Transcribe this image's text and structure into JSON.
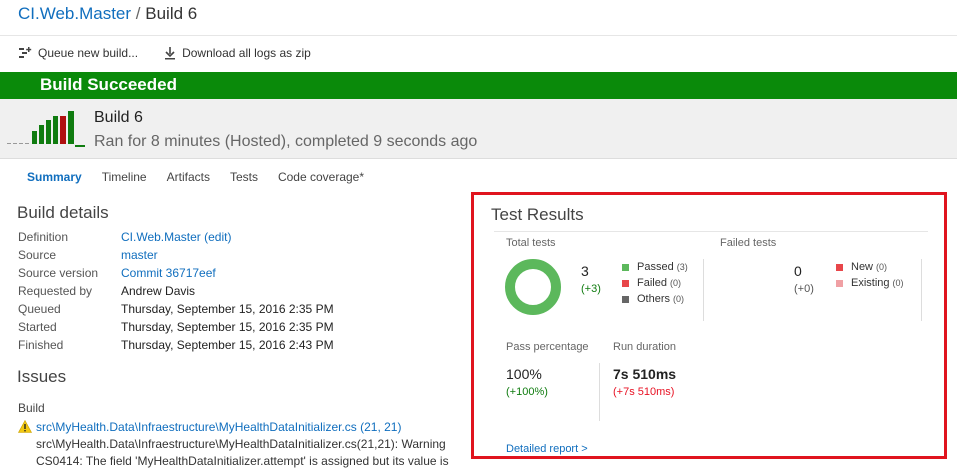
{
  "breadcrumb": {
    "project": "CI.Web.Master",
    "separator": "/",
    "build": "Build 6"
  },
  "toolbar": {
    "queue_label": "Queue new build...",
    "download_label": "Download all logs as zip"
  },
  "banner": {
    "text": "Build Succeeded",
    "color": "#0a8a0a"
  },
  "build": {
    "title": "Build 6",
    "subtitle": "Ran for 8 minutes (Hosted), completed 9 seconds ago"
  },
  "tabs": [
    {
      "label": "Summary",
      "active": true
    },
    {
      "label": "Timeline",
      "active": false
    },
    {
      "label": "Artifacts",
      "active": false
    },
    {
      "label": "Tests",
      "active": false
    },
    {
      "label": "Code coverage*",
      "active": false
    }
  ],
  "details": {
    "title": "Build details",
    "rows": [
      {
        "label": "Definition",
        "value": "CI.Web.Master (edit)",
        "link": true
      },
      {
        "label": "Source",
        "value": "master",
        "link": true
      },
      {
        "label": "Source version",
        "value": "Commit 36717eef",
        "link": true
      },
      {
        "label": "Requested by",
        "value": "Andrew Davis",
        "link": false
      },
      {
        "label": "Queued",
        "value": "Thursday, September 15, 2016 2:35 PM",
        "link": false
      },
      {
        "label": "Started",
        "value": "Thursday, September 15, 2016 2:35 PM",
        "link": false
      },
      {
        "label": "Finished",
        "value": "Thursday, September 15, 2016 2:43 PM",
        "link": false
      }
    ]
  },
  "issues": {
    "title": "Issues",
    "group": "Build",
    "items": [
      {
        "link": "src\\MyHealth.Data\\Infraestructure\\MyHealthDataInitializer.cs (21, 21)",
        "message": "src\\MyHealth.Data\\Infraestructure\\MyHealthDataInitializer.cs(21,21): Warning CS0414: The field 'MyHealthDataInitializer.attempt' is assigned but its value is"
      }
    ]
  },
  "tests": {
    "title": "Test Results",
    "total_label": "Total tests",
    "total": "3",
    "total_delta": "(+3)",
    "legend": [
      {
        "label": "Passed",
        "count": "(3)",
        "color": "#5cb85c"
      },
      {
        "label": "Failed",
        "count": "(0)",
        "color": "#e8464a"
      },
      {
        "label": "Others",
        "count": "(0)",
        "color": "#666666"
      }
    ],
    "failed_label": "Failed tests",
    "failed": "0",
    "failed_delta": "(+0)",
    "failed_legend": [
      {
        "label": "New",
        "count": "(0)",
        "color": "#e8464a"
      },
      {
        "label": "Existing",
        "count": "(0)",
        "color": "#f0a0a4"
      }
    ],
    "pass_label": "Pass percentage",
    "pass_value": "100%",
    "pass_delta": "(+100%)",
    "duration_label": "Run duration",
    "duration_value": "7s 510ms",
    "duration_delta": "(+7s 510ms)",
    "detailed_link": "Detailed report >"
  }
}
